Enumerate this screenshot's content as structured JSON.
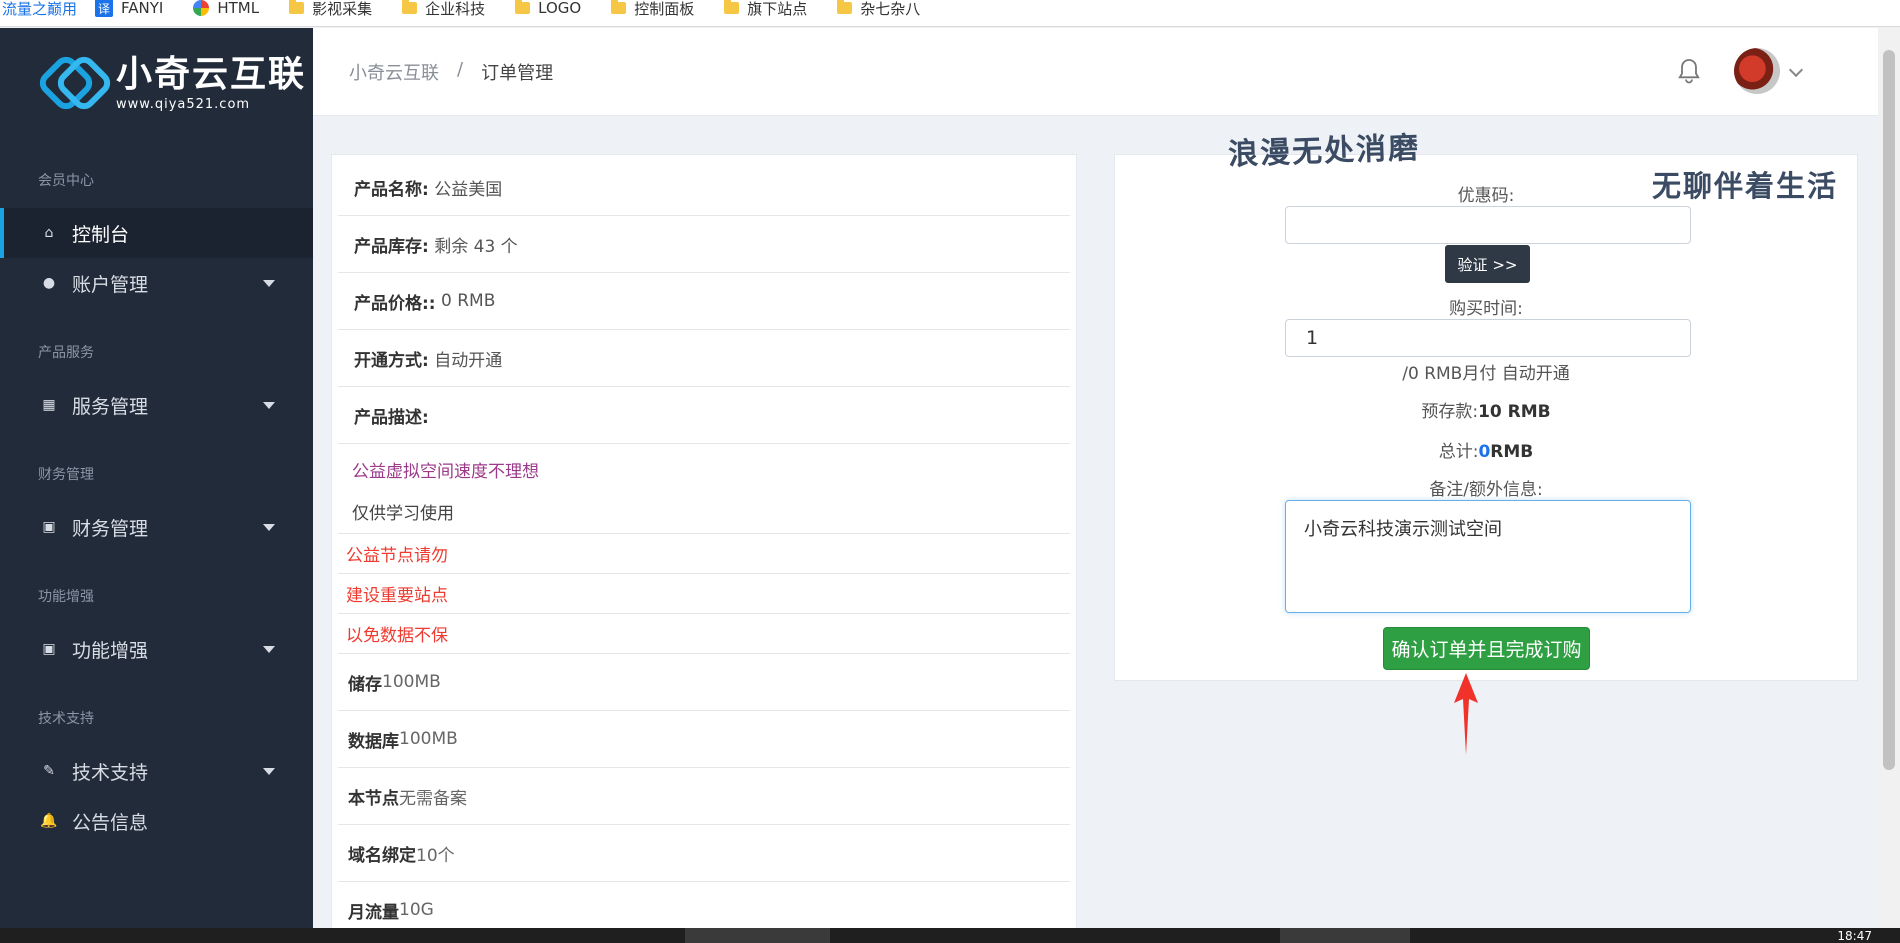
{
  "bookmarks": {
    "first": "流量之巅用",
    "items": [
      "FANYI",
      "HTML",
      "影视采集",
      "企业科技",
      "LOGO",
      "控制面板",
      "旗下站点",
      "杂七杂八"
    ]
  },
  "logo": {
    "title": "小奇云互联",
    "url": "www.qiya521.com"
  },
  "sidebar": {
    "groups": [
      {
        "label": "会员中心",
        "items": [
          {
            "label": "控制台",
            "icon": "home-icon"
          },
          {
            "label": "账户管理",
            "icon": "user-icon"
          }
        ]
      },
      {
        "label": "产品服务",
        "items": [
          {
            "label": "服务管理",
            "icon": "grid-icon"
          }
        ]
      },
      {
        "label": "财务管理",
        "items": [
          {
            "label": "财务管理",
            "icon": "wallet-icon"
          }
        ]
      },
      {
        "label": "功能增强",
        "items": [
          {
            "label": "功能增强",
            "icon": "wallet-icon"
          }
        ]
      },
      {
        "label": "技术支持",
        "items": [
          {
            "label": "技术支持",
            "icon": "ticket-icon"
          },
          {
            "label": "公告信息",
            "icon": "bell-icon"
          }
        ]
      }
    ]
  },
  "breadcrumb": {
    "home": "小奇云互联",
    "separator": "/",
    "current": "订单管理"
  },
  "product": {
    "name_label": "产品名称:",
    "name_value": "公益美国",
    "stock_label": "产品库存:",
    "stock_value": "剩余 43 个",
    "price_label": "产品价格::",
    "price_value": "0 RMB",
    "open_label": "开通方式:",
    "open_value": "自动开通",
    "desc_label": "产品描述:",
    "desc_purple": "公益虚拟空间速度不理想",
    "desc_plain": "仅供学习使用",
    "desc_red": [
      "公益节点请勿",
      "建设重要站点",
      "以免数据不保"
    ],
    "specs": [
      {
        "k": "储存",
        "v": "100MB"
      },
      {
        "k": "数据库",
        "v": "100MB"
      },
      {
        "k": "本节点",
        "v": "无需备案"
      },
      {
        "k": "域名绑定",
        "v": "10个"
      },
      {
        "k": "月流量",
        "v": "10G"
      }
    ]
  },
  "order": {
    "coupon_label": "优惠码:",
    "coupon_value": "",
    "verify_btn": "验证 >>",
    "time_label": "购买时间:",
    "time_value": "1",
    "period_note": "/0 RMB月付 自动开通",
    "deposit_label": "预存款:",
    "deposit_value": "10 RMB",
    "total_label": "总计:",
    "total_num": "0",
    "total_unit": "RMB",
    "remark_label": "备注/额外信息:",
    "remark_value": "小奇云科技演示测试空间",
    "confirm_btn": "确认订单并且完成订购"
  },
  "watermarks": {
    "line1": "浪漫无处消磨",
    "line2": "无聊伴着生活"
  },
  "taskbar": {
    "time": "18:47"
  },
  "colors": {
    "accent": "#1aa3e0",
    "sidebar_bg": "#222b39",
    "confirm": "#2ea043",
    "desc_red": "#ef3a2f",
    "desc_purple": "#9b3a8a"
  }
}
